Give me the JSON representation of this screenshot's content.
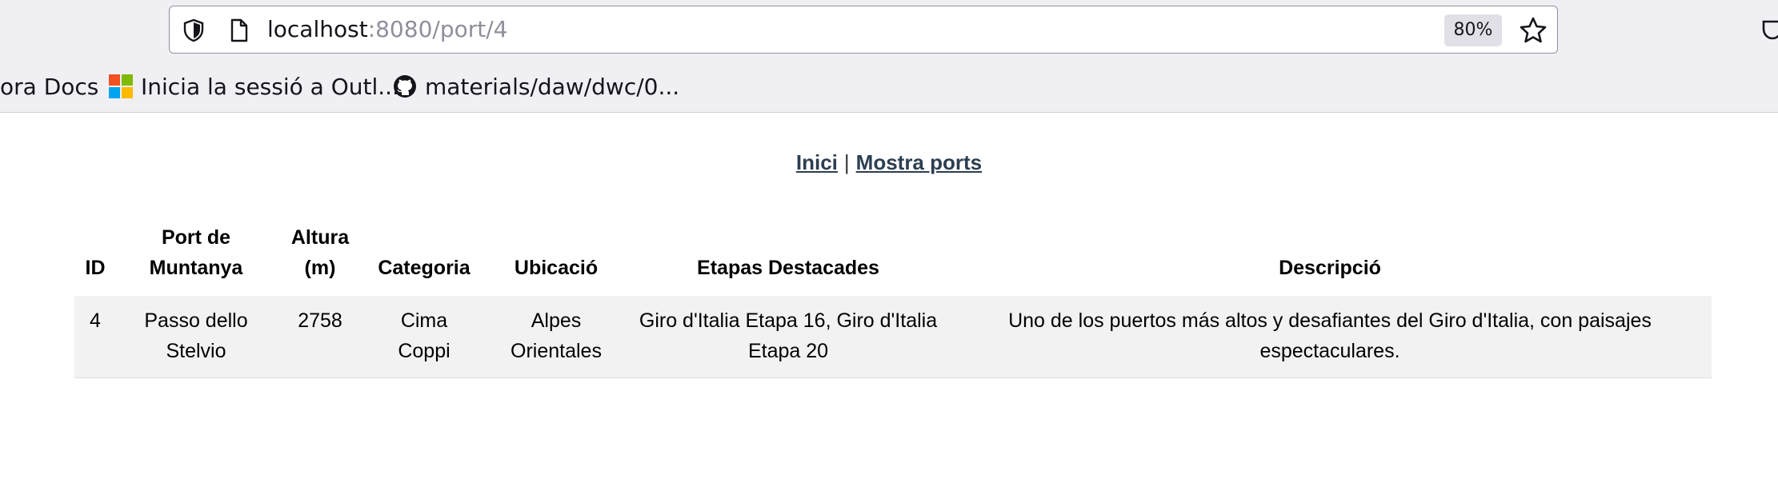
{
  "browser": {
    "url_host": "localhost",
    "url_path": ":8080/port/4",
    "zoom": "80%",
    "bookmarks": [
      {
        "label": "ora Docs",
        "icon": "none"
      },
      {
        "label": "Inicia la sessió a Outl...",
        "icon": "microsoft-icon"
      },
      {
        "label": "materials/daw/dwc/0...",
        "icon": "github-icon"
      }
    ]
  },
  "nav": {
    "home_label": "Inici",
    "separator": "|",
    "ports_label": "Mostra ports"
  },
  "table": {
    "headers": {
      "id": "ID",
      "port": "Port de Muntanya",
      "altura": "Altura (m)",
      "categoria": "Categoria",
      "ubicacio": "Ubicació",
      "etapas": "Etapas Destacades",
      "descripcio": "Descripció"
    },
    "rows": [
      {
        "id": "4",
        "port": "Passo dello Stelvio",
        "altura": "2758",
        "categoria": "Cima Coppi",
        "ubicacio": "Alpes Orientales",
        "etapas": "Giro d'Italia Etapa 16, Giro d'Italia Etapa 20",
        "descripcio": "Uno de los puertos más altos y desafiantes del Giro d'Italia, con paisajes espectaculares."
      }
    ]
  },
  "colors": {
    "chrome_bg": "#f0f0f4",
    "link": "#2c3e50",
    "row_bg": "#f2f2f2"
  }
}
